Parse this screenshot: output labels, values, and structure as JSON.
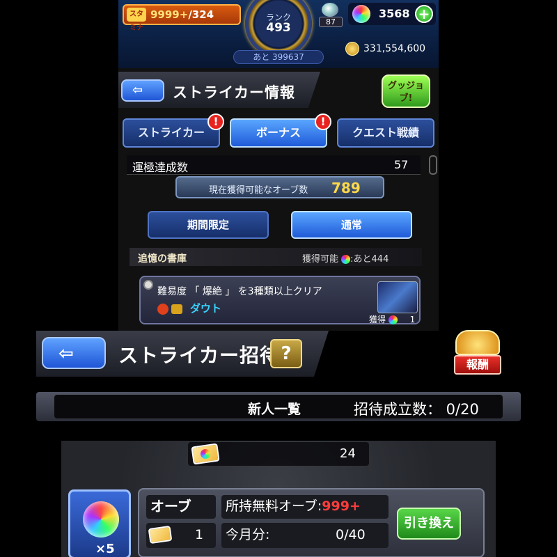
{
  "status": {
    "stamina_label": "スタミナ",
    "stamina_current": "9999+",
    "stamina_max": "/324",
    "rank_label": "ランク",
    "rank_value": "493",
    "rank_next": "あと 399637",
    "item_count": "87",
    "orb_count": "3568",
    "plus_label": "+",
    "gold": "331,554,600"
  },
  "striker_info": {
    "back_label": "⇦",
    "title": "ストライカー情報",
    "guts_label": "グッジョブ!",
    "tabs": [
      {
        "label": "ストライカー",
        "badge": "!"
      },
      {
        "label": "ボーナス",
        "badge": "!"
      },
      {
        "label": "クエスト戦績",
        "badge": ""
      }
    ],
    "lucky_label": "運極達成数",
    "lucky_value": "57",
    "orb_avail_label": "現在獲得可能なオーブ数",
    "orb_avail_value": "789",
    "subtabs": [
      "期間限定",
      "通常"
    ],
    "quest_section_title": "追憶の書庫",
    "quest_avail_prefix": "獲得可能",
    "quest_avail_suffix": ":あと444",
    "quest_text": "難易度 「 爆絶 」 を3種類以上クリア",
    "quest_stage": "ダウト",
    "quest_reward_prefix": "獲得",
    "quest_reward_value": "1"
  },
  "striker_invite": {
    "back_label": "⇦",
    "title": "ストライカー招待",
    "help_label": "?",
    "reward_label": "報酬",
    "newbie_title": "新人一覧",
    "invite_count": "招待成立数： 0/20"
  },
  "orb_exchange": {
    "ticket_count": "24",
    "orb_multiplier": "×5",
    "name": "オーブ",
    "free_label": "所持無料オーブ:",
    "free_value": "999+",
    "ticket_value": "1",
    "month_label": "今月分:",
    "month_value": "0/40",
    "exchange_label": "引き換え"
  }
}
